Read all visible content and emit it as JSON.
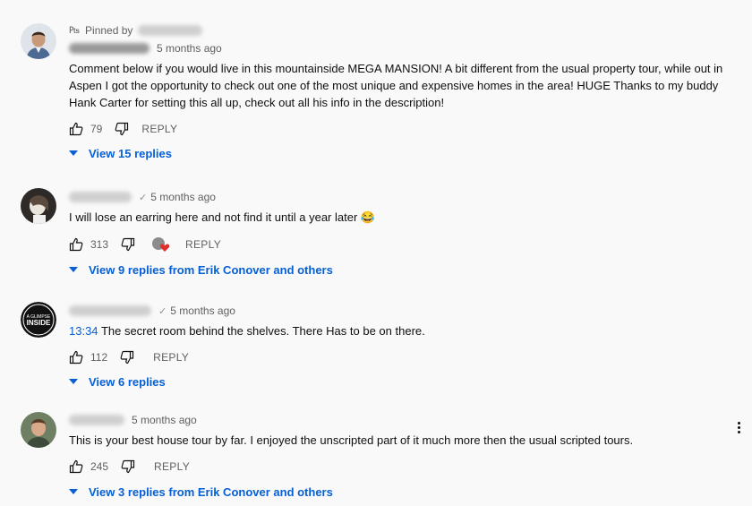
{
  "comments": [
    {
      "pinned_label": "Pinned by",
      "time": "5 months ago",
      "text": "Comment below if you would live in this mountainside MEGA MANSION! A bit different from the usual property tour, while out in Aspen I got the opportunity to check out one of the most unique and expensive homes in the area! HUGE Thanks to my buddy Hank Carter for setting this all up, check out all his info in the description!",
      "likes": "79",
      "reply_label": "REPLY",
      "replies_label": "View 15 replies"
    },
    {
      "time": "5 months ago",
      "text": "I will lose an earring here and not find it until a year later",
      "emoji": "😂",
      "likes": "313",
      "reply_label": "REPLY",
      "replies_label": "View 9 replies from Erik Conover and others"
    },
    {
      "time": "5 months ago",
      "timestamp_link": "13:34",
      "text": "The secret room behind the shelves. There Has to be on there.",
      "likes": "112",
      "reply_label": "REPLY",
      "replies_label": "View 6 replies",
      "avatar_text": "A GLIMPSE INSIDE"
    },
    {
      "time": "5 months ago",
      "text": "This is your best house tour by far. I enjoyed the unscripted part of it much more then the usual scripted tours.",
      "likes": "245",
      "reply_label": "REPLY",
      "replies_label": "View 3 replies from Erik Conover and others"
    }
  ],
  "colors": {
    "link": "#065fd4",
    "meta": "#606060",
    "background": "#f9f9f9"
  }
}
